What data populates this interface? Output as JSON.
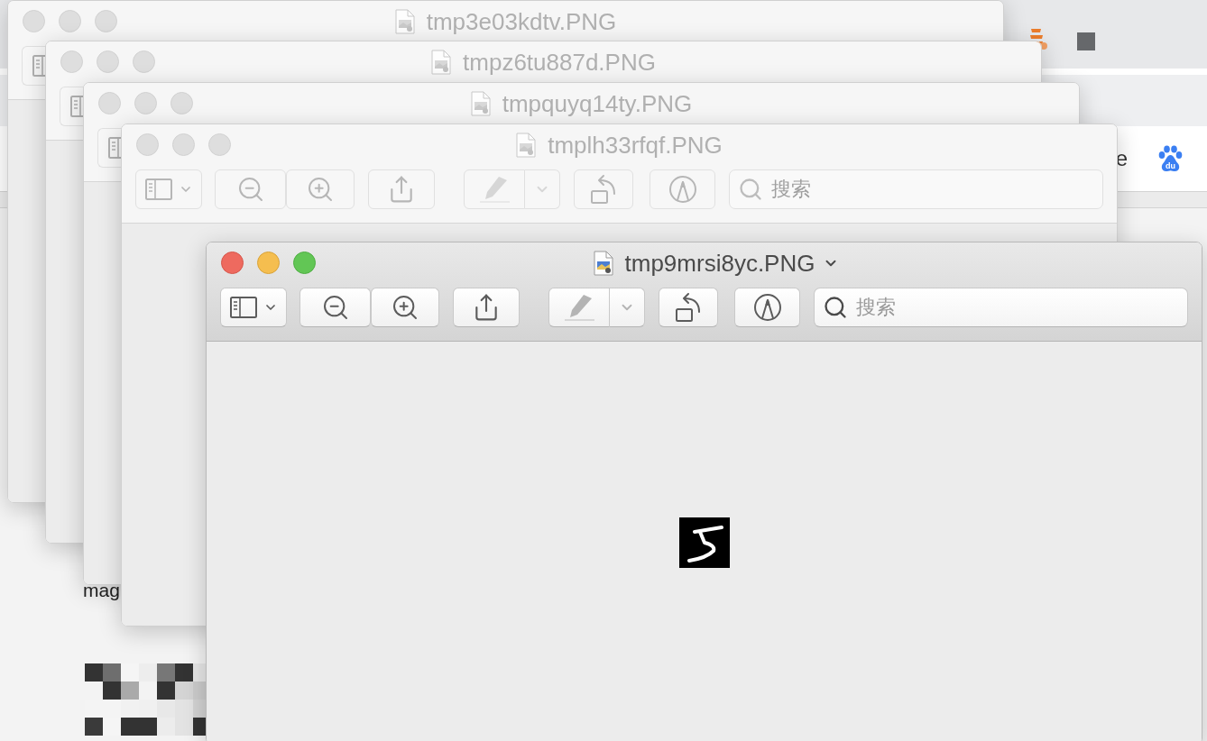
{
  "browser": {
    "bookmark_text": "e",
    "logo_text": "du",
    "page_text": "mag"
  },
  "windows": [
    {
      "kind": "partial",
      "title": "tmp3e03kdtv.PNG",
      "active": false
    },
    {
      "kind": "partial",
      "title": "tmpz6tu887d.PNG",
      "active": false
    },
    {
      "kind": "partial",
      "title": "tmpquyq14ty.PNG",
      "active": false
    },
    {
      "kind": "full",
      "title": "tmplh33rfqf.PNG",
      "active": false,
      "markup_disabled": true,
      "search": {
        "placeholder": "搜索"
      }
    },
    {
      "kind": "full",
      "title": "tmp9mrsi8yc.PNG",
      "active": true,
      "markup_disabled": true,
      "search": {
        "placeholder": "搜索"
      }
    }
  ]
}
